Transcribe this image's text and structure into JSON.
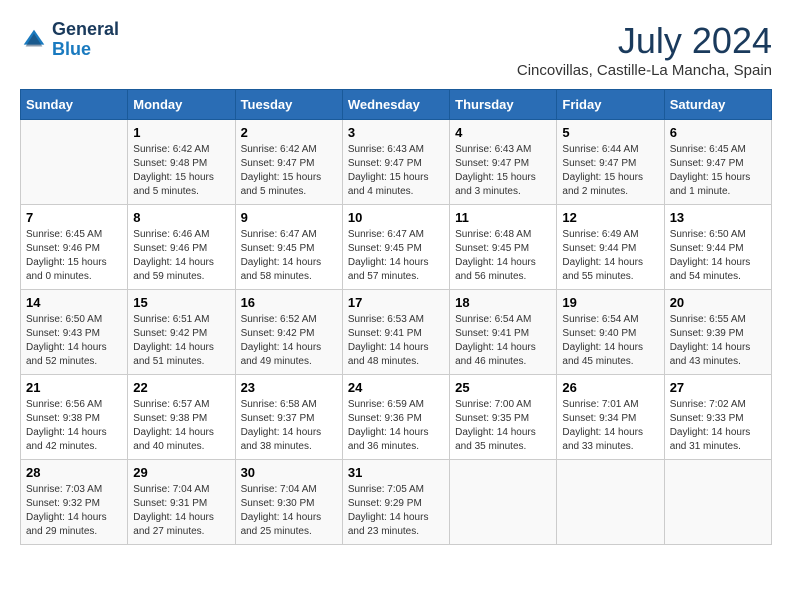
{
  "header": {
    "logo_line1": "General",
    "logo_line2": "Blue",
    "month_year": "July 2024",
    "location": "Cincovillas, Castille-La Mancha, Spain"
  },
  "weekdays": [
    "Sunday",
    "Monday",
    "Tuesday",
    "Wednesday",
    "Thursday",
    "Friday",
    "Saturday"
  ],
  "weeks": [
    [
      {
        "day": "",
        "info": ""
      },
      {
        "day": "1",
        "info": "Sunrise: 6:42 AM\nSunset: 9:48 PM\nDaylight: 15 hours\nand 5 minutes."
      },
      {
        "day": "2",
        "info": "Sunrise: 6:42 AM\nSunset: 9:47 PM\nDaylight: 15 hours\nand 5 minutes."
      },
      {
        "day": "3",
        "info": "Sunrise: 6:43 AM\nSunset: 9:47 PM\nDaylight: 15 hours\nand 4 minutes."
      },
      {
        "day": "4",
        "info": "Sunrise: 6:43 AM\nSunset: 9:47 PM\nDaylight: 15 hours\nand 3 minutes."
      },
      {
        "day": "5",
        "info": "Sunrise: 6:44 AM\nSunset: 9:47 PM\nDaylight: 15 hours\nand 2 minutes."
      },
      {
        "day": "6",
        "info": "Sunrise: 6:45 AM\nSunset: 9:47 PM\nDaylight: 15 hours\nand 1 minute."
      }
    ],
    [
      {
        "day": "7",
        "info": "Sunrise: 6:45 AM\nSunset: 9:46 PM\nDaylight: 15 hours\nand 0 minutes."
      },
      {
        "day": "8",
        "info": "Sunrise: 6:46 AM\nSunset: 9:46 PM\nDaylight: 14 hours\nand 59 minutes."
      },
      {
        "day": "9",
        "info": "Sunrise: 6:47 AM\nSunset: 9:45 PM\nDaylight: 14 hours\nand 58 minutes."
      },
      {
        "day": "10",
        "info": "Sunrise: 6:47 AM\nSunset: 9:45 PM\nDaylight: 14 hours\nand 57 minutes."
      },
      {
        "day": "11",
        "info": "Sunrise: 6:48 AM\nSunset: 9:45 PM\nDaylight: 14 hours\nand 56 minutes."
      },
      {
        "day": "12",
        "info": "Sunrise: 6:49 AM\nSunset: 9:44 PM\nDaylight: 14 hours\nand 55 minutes."
      },
      {
        "day": "13",
        "info": "Sunrise: 6:50 AM\nSunset: 9:44 PM\nDaylight: 14 hours\nand 54 minutes."
      }
    ],
    [
      {
        "day": "14",
        "info": "Sunrise: 6:50 AM\nSunset: 9:43 PM\nDaylight: 14 hours\nand 52 minutes."
      },
      {
        "day": "15",
        "info": "Sunrise: 6:51 AM\nSunset: 9:42 PM\nDaylight: 14 hours\nand 51 minutes."
      },
      {
        "day": "16",
        "info": "Sunrise: 6:52 AM\nSunset: 9:42 PM\nDaylight: 14 hours\nand 49 minutes."
      },
      {
        "day": "17",
        "info": "Sunrise: 6:53 AM\nSunset: 9:41 PM\nDaylight: 14 hours\nand 48 minutes."
      },
      {
        "day": "18",
        "info": "Sunrise: 6:54 AM\nSunset: 9:41 PM\nDaylight: 14 hours\nand 46 minutes."
      },
      {
        "day": "19",
        "info": "Sunrise: 6:54 AM\nSunset: 9:40 PM\nDaylight: 14 hours\nand 45 minutes."
      },
      {
        "day": "20",
        "info": "Sunrise: 6:55 AM\nSunset: 9:39 PM\nDaylight: 14 hours\nand 43 minutes."
      }
    ],
    [
      {
        "day": "21",
        "info": "Sunrise: 6:56 AM\nSunset: 9:38 PM\nDaylight: 14 hours\nand 42 minutes."
      },
      {
        "day": "22",
        "info": "Sunrise: 6:57 AM\nSunset: 9:38 PM\nDaylight: 14 hours\nand 40 minutes."
      },
      {
        "day": "23",
        "info": "Sunrise: 6:58 AM\nSunset: 9:37 PM\nDaylight: 14 hours\nand 38 minutes."
      },
      {
        "day": "24",
        "info": "Sunrise: 6:59 AM\nSunset: 9:36 PM\nDaylight: 14 hours\nand 36 minutes."
      },
      {
        "day": "25",
        "info": "Sunrise: 7:00 AM\nSunset: 9:35 PM\nDaylight: 14 hours\nand 35 minutes."
      },
      {
        "day": "26",
        "info": "Sunrise: 7:01 AM\nSunset: 9:34 PM\nDaylight: 14 hours\nand 33 minutes."
      },
      {
        "day": "27",
        "info": "Sunrise: 7:02 AM\nSunset: 9:33 PM\nDaylight: 14 hours\nand 31 minutes."
      }
    ],
    [
      {
        "day": "28",
        "info": "Sunrise: 7:03 AM\nSunset: 9:32 PM\nDaylight: 14 hours\nand 29 minutes."
      },
      {
        "day": "29",
        "info": "Sunrise: 7:04 AM\nSunset: 9:31 PM\nDaylight: 14 hours\nand 27 minutes."
      },
      {
        "day": "30",
        "info": "Sunrise: 7:04 AM\nSunset: 9:30 PM\nDaylight: 14 hours\nand 25 minutes."
      },
      {
        "day": "31",
        "info": "Sunrise: 7:05 AM\nSunset: 9:29 PM\nDaylight: 14 hours\nand 23 minutes."
      },
      {
        "day": "",
        "info": ""
      },
      {
        "day": "",
        "info": ""
      },
      {
        "day": "",
        "info": ""
      }
    ]
  ]
}
